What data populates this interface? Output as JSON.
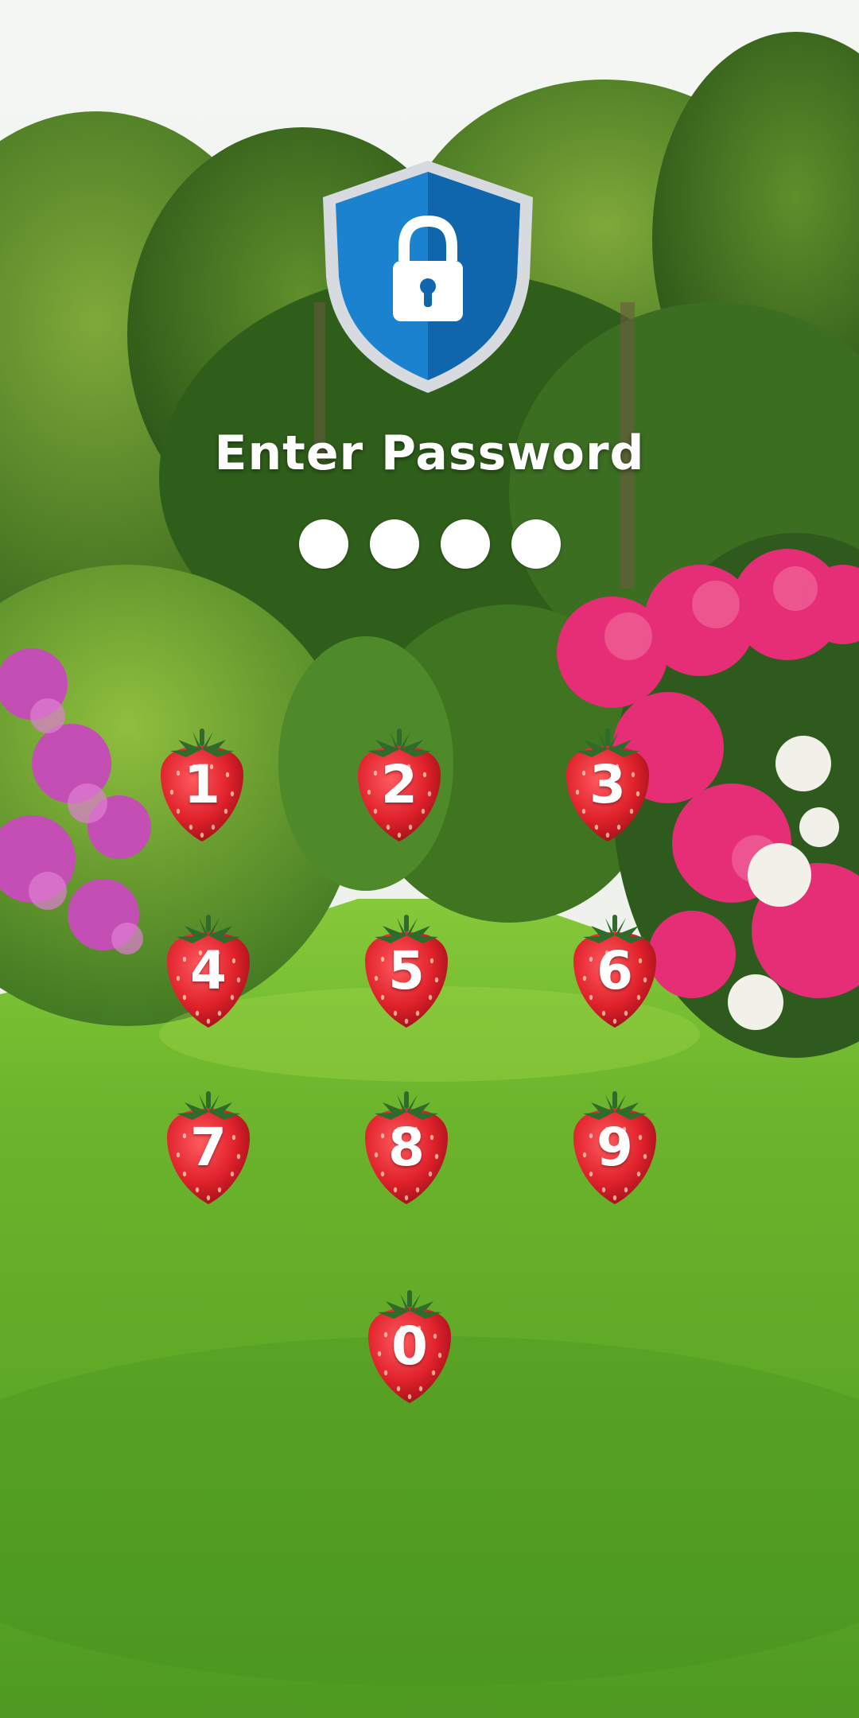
{
  "lock_screen": {
    "title": "Enter Password",
    "pin_length": 4,
    "entered_count": 0,
    "keys": [
      {
        "digit": "1"
      },
      {
        "digit": "2"
      },
      {
        "digit": "3"
      },
      {
        "digit": "4"
      },
      {
        "digit": "5"
      },
      {
        "digit": "6"
      },
      {
        "digit": "7"
      },
      {
        "digit": "8"
      },
      {
        "digit": "9"
      },
      {
        "digit": "0"
      }
    ]
  },
  "icons": {
    "header": "shield-lock-icon",
    "key": "strawberry-icon"
  },
  "colors": {
    "shield_blue": "#1a82cf",
    "shield_dark": "#0f66ad",
    "shield_rim": "#d7dbe0",
    "strawberry_red": "#e0222c",
    "leaf_green": "#2f6b2a",
    "text": "#ffffff"
  }
}
